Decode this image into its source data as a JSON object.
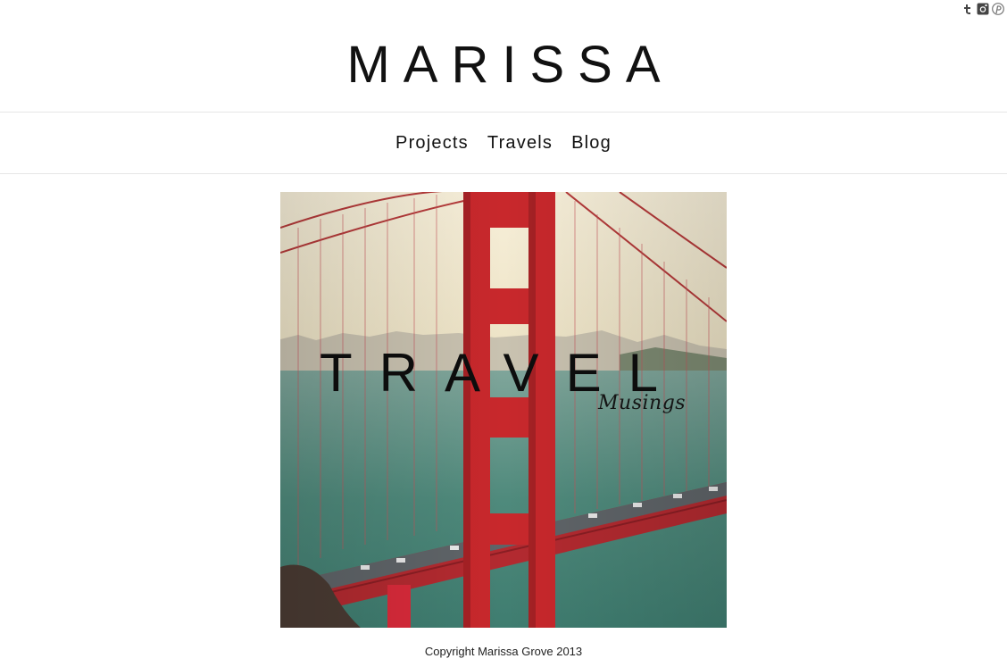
{
  "site": {
    "title": "MARISSA"
  },
  "social": [
    {
      "name": "tumblr-icon"
    },
    {
      "name": "instagram-icon"
    },
    {
      "name": "pinterest-icon"
    }
  ],
  "nav": {
    "items": [
      {
        "label": "Projects"
      },
      {
        "label": "Travels"
      },
      {
        "label": "Blog"
      }
    ]
  },
  "hero": {
    "title": "TRAVEL",
    "subtitle": "Musings",
    "colors": {
      "bridge_red": "#c8282c",
      "sky": "#f3ead2",
      "water": "#4f8a7c"
    }
  },
  "footer": {
    "copyright": "Copyright Marissa Grove 2013"
  }
}
